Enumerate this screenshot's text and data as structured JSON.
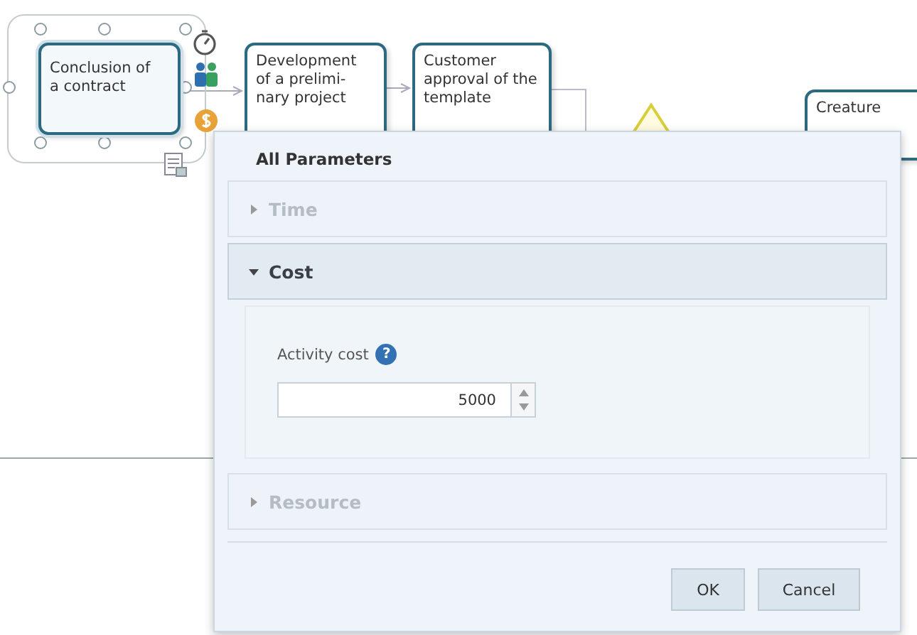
{
  "diagram": {
    "nodes": [
      {
        "lines": [
          "Conclusion of",
          "a contract"
        ],
        "selected": true
      },
      {
        "lines": [
          "Development",
          "of a prelimi-",
          "nary project"
        ],
        "selected": false
      },
      {
        "lines": [
          "Customer",
          "approval of the",
          "template"
        ],
        "selected": false
      },
      {
        "lines": [
          "Creature"
        ],
        "selected": false
      }
    ]
  },
  "dialog": {
    "title": "All Parameters",
    "sections": [
      {
        "label": "Time",
        "expanded": false
      },
      {
        "label": "Cost",
        "expanded": true,
        "field": {
          "label": "Activity cost",
          "help": "?",
          "value": "5000"
        }
      },
      {
        "label": "Resource",
        "expanded": false
      }
    ],
    "buttons": [
      "OK",
      "Cancel"
    ]
  }
}
